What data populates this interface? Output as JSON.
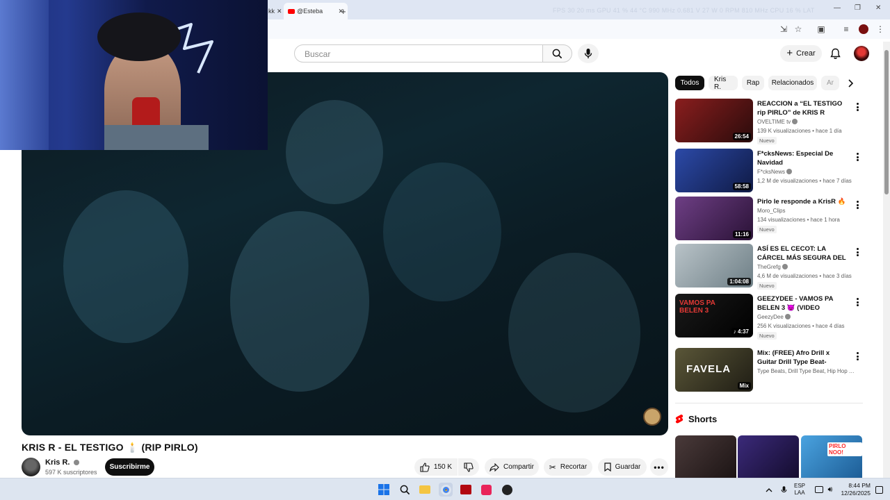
{
  "browser": {
    "tabs": [
      {
        "label": "kk"
      },
      {
        "label": "@Esteba"
      }
    ],
    "new_tab": "+",
    "overlay_stats": "FPS  30   20 ms     GPU  41 %  44 °C  990 MHz  0.681 V  27 W  0 RPM  810 MHz      CPU  16 %     LAT"
  },
  "header": {
    "search_placeholder": "Buscar",
    "create_label": "Crear"
  },
  "video": {
    "title": "KRIS R - EL TESTIGO 🕯️ (RIP PIRLO)",
    "channel": "Kris R.",
    "subscribers": "597 K suscriptores",
    "subscribe_label": "Suscribirme",
    "likes": "150 K",
    "share_label": "Compartir",
    "clip_label": "Recortar",
    "save_label": "Guardar"
  },
  "chips": [
    "Todos",
    "Kris R.",
    "Rap",
    "Relacionados",
    "Ar"
  ],
  "recommendations": [
    {
      "title": "REACCION a “EL TESTIGO rip PIRLO” de KRIS R ¿quién ...",
      "channel": "OVELTIME tv",
      "meta": "139 K visualizaciones • hace 1 día",
      "badge": "Nuevo",
      "duration": "26:54",
      "thumb_color": "#8a1e1e",
      "verified": true
    },
    {
      "title": "F*cksNews: Especial De Navidad",
      "channel": "F*cksNews",
      "meta": "1,2 M de visualizaciones • hace 7 días",
      "badge": "",
      "duration": "58:58",
      "thumb_color": "#1e2f6e",
      "verified": true
    },
    {
      "title": "Pirlo le responde a KrisR 🔥",
      "channel": "Moro_Clips",
      "meta": "134 visualizaciones • hace 1 hora",
      "badge": "Nuevo",
      "duration": "11:16",
      "thumb_color": "#5a2f6a",
      "verified": false
    },
    {
      "title": "ASÍ ES EL CECOT: LA CÁRCEL MÁS SEGURA DEL MUNDO",
      "channel": "TheGrefg",
      "meta": "4,6 M de visualizaciones • hace 3 días",
      "badge": "Nuevo",
      "duration": "1:04:08",
      "thumb_color": "#a7b3b8",
      "verified": true
    },
    {
      "title": "GEEZYDEE - VAMOS PA BELEN 3 😈 (VIDEO OFICIAL)",
      "channel": "GeezyDee",
      "meta": "256 K visualizaciones • hace 4 días",
      "badge": "Nuevo",
      "duration": "♪ 4:37",
      "thumb_color": "#141414",
      "verified": true
    },
    {
      "title": "Mix: (FREE) Afro Drill x Guitar Drill Type Beat- \"FAVELA\" | ...",
      "channel": "Type Beats, Drill Type Beat, Hip Hop Type...",
      "meta": "",
      "badge": "",
      "duration": "Mix",
      "thumb_color": "#3b3a2a",
      "verified": false
    }
  ],
  "shorts": {
    "header": "Shorts",
    "items": [
      {
        "thumb_color": "#3a3030"
      },
      {
        "thumb_color": "#2c1e5a"
      },
      {
        "thumb_color": "#3a8fd0",
        "label": "PIRLO NOO!"
      }
    ]
  },
  "taskbar": {
    "lang_top": "ESP",
    "lang_bottom": "LAA",
    "time": "8:44 PM",
    "date": "12/26/2025"
  },
  "colors": {
    "accent_red": "#ff0000",
    "chip_active": "#0f0f0f",
    "chip_bg": "#f2f2f2"
  }
}
